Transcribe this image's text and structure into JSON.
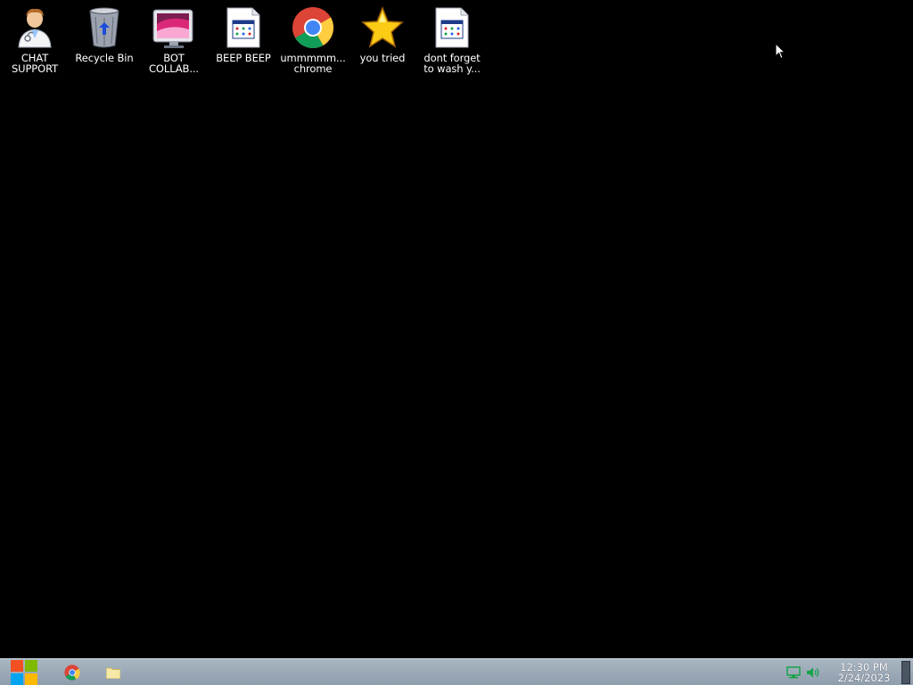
{
  "desktop": {
    "icons": [
      {
        "name": "chat-support-icon",
        "label": "CHAT\nSUPPORT"
      },
      {
        "name": "recycle-bin-icon",
        "label": "Recycle Bin"
      },
      {
        "name": "bot-collab-icon",
        "label": "BOT\nCOLLAB..."
      },
      {
        "name": "beep-beep-icon",
        "label": "BEEP BEEP"
      },
      {
        "name": "chrome-icon",
        "label": "ummmmm...\nchrome"
      },
      {
        "name": "star-icon",
        "label": "you tried"
      },
      {
        "name": "document-icon",
        "label": "dont forget\nto wash y..."
      }
    ]
  },
  "taskbar": {
    "start_icon": "windows-logo-icon",
    "pinned": [
      {
        "name": "chrome-icon"
      },
      {
        "name": "folder-icon"
      }
    ],
    "tray": {
      "network_icon": "network-monitor-icon",
      "volume_icon": "speaker-icon"
    },
    "clock": {
      "time": "12:30 PM",
      "date": "2/24/2023"
    }
  },
  "colors": {
    "desktop_background": "#000000",
    "taskbar_background": "#9aa8b6",
    "label_text": "#ffffff"
  }
}
